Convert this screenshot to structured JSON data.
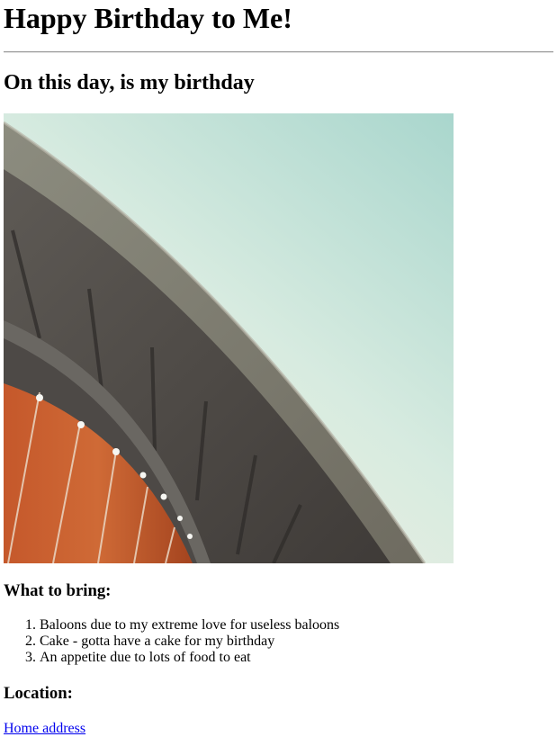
{
  "page": {
    "title": "Happy Birthday to Me!",
    "subtitle": "On this day, is my birthday"
  },
  "bring": {
    "heading": "What to bring:",
    "items": [
      "Baloons due to my extreme love for useless baloons",
      "Cake - gotta have a cake for my birthday",
      "An appetite due to lots of food to eat"
    ]
  },
  "location": {
    "heading": "Location:",
    "link_label": "Home address"
  },
  "colors": {
    "link": "#0000ee",
    "sky": "#b9ddd6",
    "copper": "#c45a2c",
    "concrete": "#7c7c70"
  }
}
